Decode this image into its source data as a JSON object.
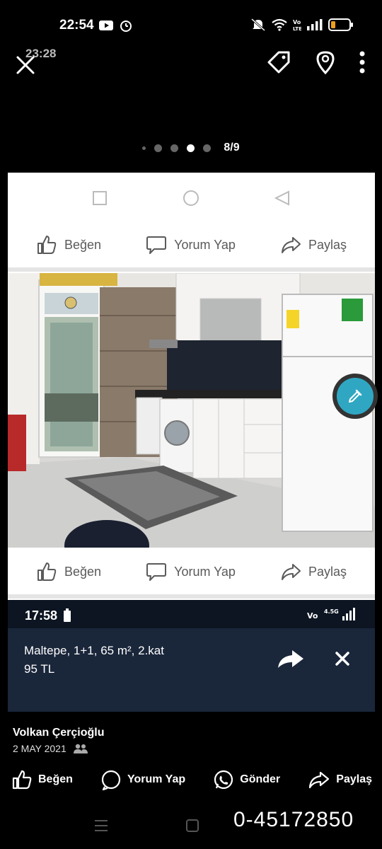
{
  "status_bar": {
    "time": "22:54"
  },
  "overlay_status": {
    "ghost_time": "23:28"
  },
  "gallery": {
    "counter": "8/9",
    "dots_total": 5,
    "active_dot": 3
  },
  "post_actions_row": {
    "like": "Beğen",
    "comment": "Yorum Yap",
    "share": "Paylaş"
  },
  "embedded_screenshot": {
    "time": "17:58",
    "listing_title": "Maltepe, 1+1, 65 m², 2.kat",
    "listing_price": "95 TL"
  },
  "poster": {
    "name": "Volkan Çerçioğlu",
    "date": "2 MAY 2021"
  },
  "bottom_actions": {
    "like": "Beğen",
    "comment": "Yorum Yap",
    "send": "Gönder",
    "share": "Paylaş"
  },
  "phone_number": "0-45172850",
  "colors": {
    "background": "#000000",
    "card": "#ffffff",
    "panel": "#1a263a",
    "fab": "#2fa7c3"
  }
}
